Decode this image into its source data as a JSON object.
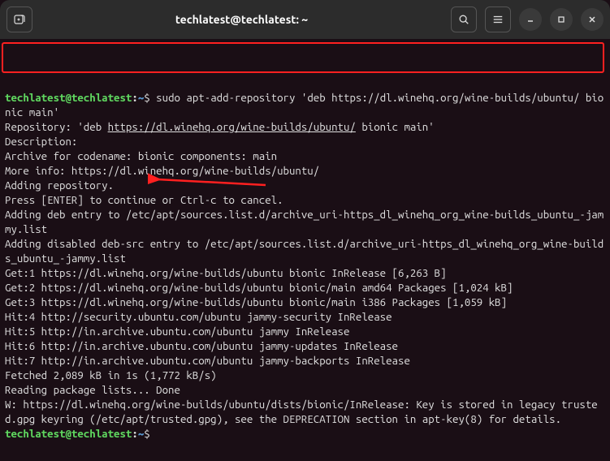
{
  "window": {
    "title": "techlatest@techlatest: ~"
  },
  "prompt": {
    "user_host": "techlatest@techlatest",
    "colon": ":",
    "path": "~",
    "dollar": "$"
  },
  "command1": " sudo apt-add-repository 'deb https://dl.winehq.org/wine-builds/ubuntu/ bionic main'",
  "output": {
    "l1a": "Repository: 'deb ",
    "l1link": "https://dl.winehq.org/wine-builds/ubuntu/",
    "l1b": " bionic main'",
    "l2": "Description:",
    "l3": "Archive for codename: bionic components: main",
    "l4": "More info: https://dl.winehq.org/wine-builds/ubuntu/",
    "l5": "Adding repository.",
    "l6": "Press [ENTER] to continue or Ctrl-c to cancel.",
    "l7": "Adding deb entry to /etc/apt/sources.list.d/archive_uri-https_dl_winehq_org_wine-builds_ubuntu_-jammy.list",
    "l8": "Adding disabled deb-src entry to /etc/apt/sources.list.d/archive_uri-https_dl_winehq_org_wine-builds_ubuntu_-jammy.list",
    "l9": "Get:1 https://dl.winehq.org/wine-builds/ubuntu bionic InRelease [6,263 B]",
    "l10": "Get:2 https://dl.winehq.org/wine-builds/ubuntu bionic/main amd64 Packages [1,024 kB]",
    "l11": "Get:3 https://dl.winehq.org/wine-builds/ubuntu bionic/main i386 Packages [1,059 kB]",
    "l12": "Hit:4 http://security.ubuntu.com/ubuntu jammy-security InRelease",
    "l13": "Hit:5 http://in.archive.ubuntu.com/ubuntu jammy InRelease",
    "l14": "Hit:6 http://in.archive.ubuntu.com/ubuntu jammy-updates InRelease",
    "l15": "Hit:7 http://in.archive.ubuntu.com/ubuntu jammy-backports InRelease",
    "l16": "Fetched 2,089 kB in 1s (1,772 kB/s)",
    "l17": "Reading package lists... Done",
    "l18": "W: https://dl.winehq.org/wine-builds/ubuntu/dists/bionic/InRelease: Key is stored in legacy trusted.gpg keyring (/etc/apt/trusted.gpg), see the DEPRECATION section in apt-key(8) for details."
  }
}
